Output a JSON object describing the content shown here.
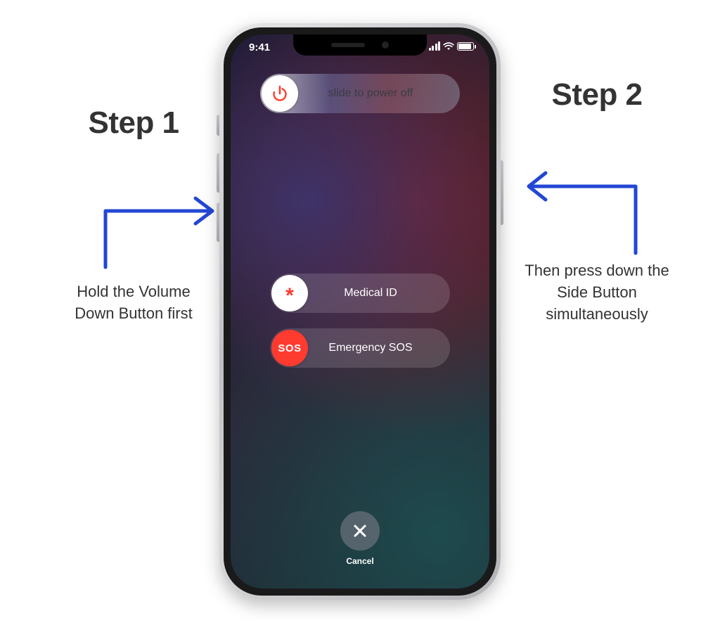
{
  "status": {
    "time": "9:41"
  },
  "sliders": {
    "power_off_label": "slide to power off",
    "medical_label": "Medical ID",
    "medical_symbol": "*",
    "sos_label": "Emergency SOS",
    "sos_badge": "SOS"
  },
  "cancel": {
    "label": "Cancel"
  },
  "annotations": {
    "step1_heading": "Step 1",
    "step1_body": "Hold the Volume Down Button first",
    "step2_heading": "Step 2",
    "step2_body": "Then press down the Side Button simultaneously"
  }
}
